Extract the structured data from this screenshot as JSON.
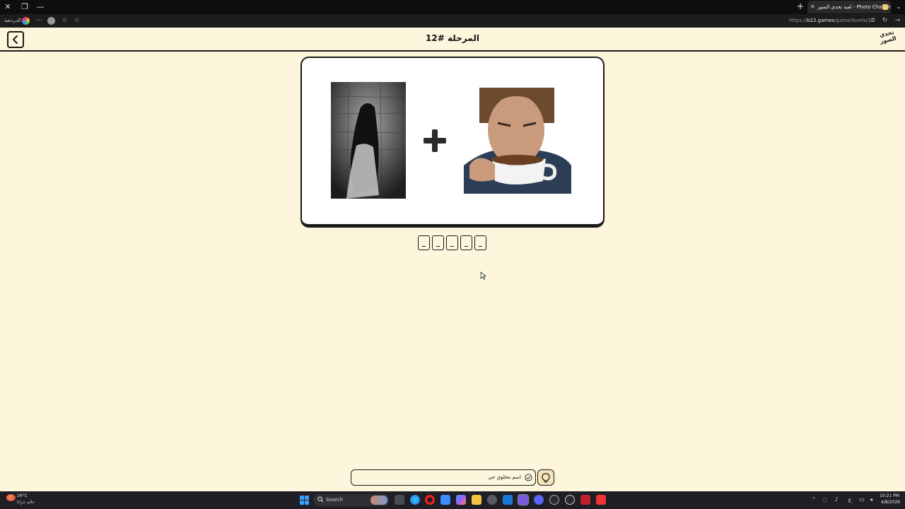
{
  "browser": {
    "tab_title": "لعبة تحدي الصور - Photo Challenge",
    "bookmark_label": "الدردشة",
    "url_domain": "b22.games",
    "url_prefix": "https://",
    "url_path": "/game/levels/12"
  },
  "game": {
    "level_title": "المرحلة #12",
    "logo_text": "تحدي الصور",
    "images": [
      {
        "icon": "ghost-woman-image"
      },
      {
        "icon": "man-drinking-coffee-image"
      }
    ],
    "operator": "+",
    "answer_slots": [
      "_",
      "_",
      "_",
      "_",
      "_"
    ],
    "hint_text": "اسم مخلوق حي"
  },
  "taskbar": {
    "weather_temp": "26°C",
    "weather_desc": "عالم جزائا",
    "search_placeholder": "Search",
    "language": "ع",
    "time": "10:21 PM",
    "date": "4/8/2026"
  },
  "colors": {
    "page_bg": "#fdf6dc",
    "outline": "#1a1a1a",
    "hint_btn_bg": "#f5e6b8",
    "accent_blue": "#3aa0ff"
  }
}
